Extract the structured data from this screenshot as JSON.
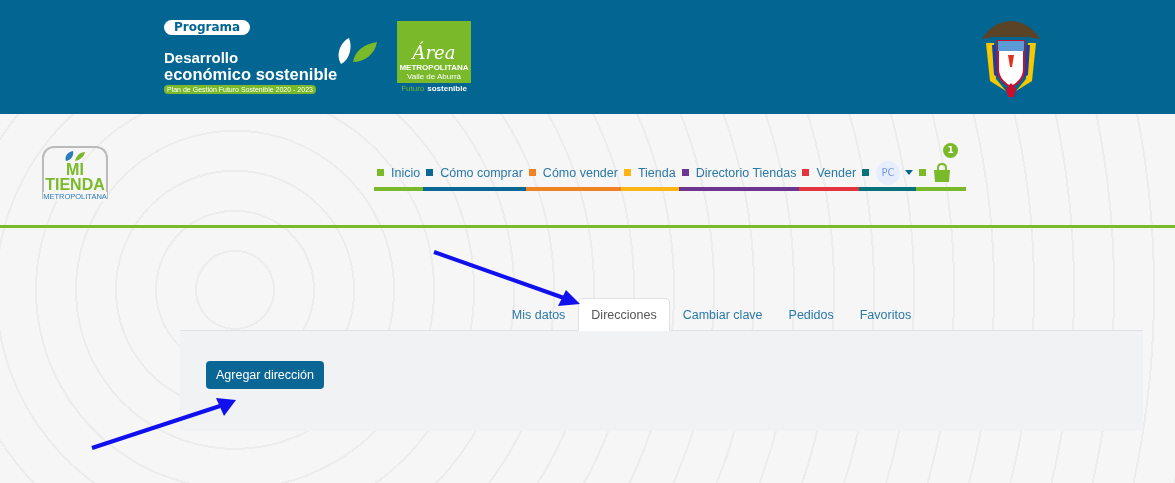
{
  "header": {
    "program_logo": {
      "badge": "Programa",
      "title_line_1": "Desarrollo",
      "title_line_2": "económico sostenible",
      "subtitle": "Plan de Gestión Futuro Sostenible 2020 - 2023"
    },
    "area_logo": {
      "script": "Área",
      "line_1": "METROPOLITANA",
      "line_2": "Valle de Aburrá",
      "tagline_1": "Futuro",
      "tagline_2": "sostenible"
    }
  },
  "site_logo": {
    "line_1": "MI",
    "line_2": "TIENDA",
    "line_3": "METROPOLITANA"
  },
  "nav": {
    "items": [
      {
        "label": "Inicio",
        "color": "#7ab929"
      },
      {
        "label": "Cómo comprar",
        "color": "#0a6694"
      },
      {
        "label": "Cómo vender",
        "color": "#f08424"
      },
      {
        "label": "Tienda",
        "color": "#fbb515"
      },
      {
        "label": "Directorio Tiendas",
        "color": "#6b3590"
      },
      {
        "label": "Vender",
        "color": "#e3343e"
      }
    ],
    "user": {
      "initials": "PC",
      "color": "#07727a"
    },
    "cart": {
      "count": "1",
      "color": "#7ab929"
    }
  },
  "tabs": [
    {
      "label": "Mis datos",
      "selected": false
    },
    {
      "label": "Direcciones",
      "selected": true
    },
    {
      "label": "Cambiar clave",
      "selected": false
    },
    {
      "label": "Pedidos",
      "selected": false
    },
    {
      "label": "Favoritos",
      "selected": false
    }
  ],
  "panel": {
    "button": "Agregar dirección"
  }
}
